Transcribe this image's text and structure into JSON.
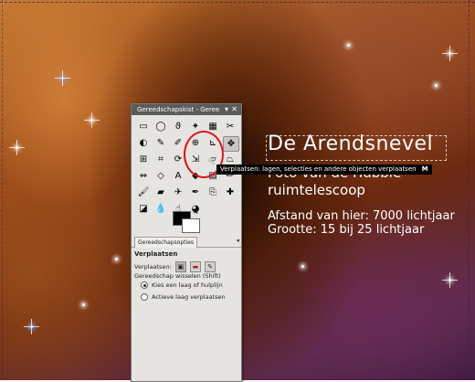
{
  "canvas": {
    "title": "De Arendsnevel",
    "subtitle_line1": "Foto van de Hubble",
    "subtitle_line2": "ruimtelescoop",
    "info_line1": "Afstand van hier: 7000 lichtjaar",
    "info_line2": "Grootte: 15 bij 25 lichtjaar"
  },
  "tooltip": {
    "text": "Verplaatsen: lagen, selecties en andere objecten verplaatsen",
    "shortcut": "M"
  },
  "toolbox": {
    "title": "Gereedschapskist - Geree",
    "controls": [
      "▾",
      "✕"
    ],
    "tools": [
      {
        "icon": "rect-select-icon",
        "glyph": "▭"
      },
      {
        "icon": "ellipse-select-icon",
        "glyph": "◯"
      },
      {
        "icon": "free-select-icon",
        "glyph": "ϑ"
      },
      {
        "icon": "fuzzy-select-icon",
        "glyph": "✦"
      },
      {
        "icon": "select-by-color-icon",
        "glyph": "▦"
      },
      {
        "icon": "scissors-select-icon",
        "glyph": "✂"
      },
      {
        "icon": "foreground-select-icon",
        "glyph": "◐"
      },
      {
        "icon": "paths-icon",
        "glyph": "✎"
      },
      {
        "icon": "color-picker-icon",
        "glyph": "✐"
      },
      {
        "icon": "zoom-icon",
        "glyph": "⊕"
      },
      {
        "icon": "measure-icon",
        "glyph": "⊾"
      },
      {
        "icon": "move-icon",
        "glyph": "✥"
      },
      {
        "icon": "align-icon",
        "glyph": "⊞"
      },
      {
        "icon": "crop-icon",
        "glyph": "⌗"
      },
      {
        "icon": "rotate-icon",
        "glyph": "⟳"
      },
      {
        "icon": "scale-icon",
        "glyph": "⇲"
      },
      {
        "icon": "shear-icon",
        "glyph": "▱"
      },
      {
        "icon": "perspective-icon",
        "glyph": "⏢"
      },
      {
        "icon": "flip-icon",
        "glyph": "⇔"
      },
      {
        "icon": "cage-icon",
        "glyph": "◇"
      },
      {
        "icon": "text-icon",
        "glyph": "A"
      },
      {
        "icon": "bucket-fill-icon",
        "glyph": "◆"
      },
      {
        "icon": "blend-icon",
        "glyph": "▤"
      },
      {
        "icon": "pencil-icon",
        "glyph": "✏"
      },
      {
        "icon": "paintbrush-icon",
        "glyph": "🖌"
      },
      {
        "icon": "eraser-icon",
        "glyph": "▰"
      },
      {
        "icon": "airbrush-icon",
        "glyph": "✈"
      },
      {
        "icon": "ink-icon",
        "glyph": "✒"
      },
      {
        "icon": "clone-icon",
        "glyph": "⎘"
      },
      {
        "icon": "heal-icon",
        "glyph": "✚"
      },
      {
        "icon": "perspective-clone-icon",
        "glyph": "◪"
      },
      {
        "icon": "blur-icon",
        "glyph": "💧"
      },
      {
        "icon": "smudge-icon",
        "glyph": "☝"
      },
      {
        "icon": "dodge-burn-icon",
        "glyph": "◕"
      }
    ],
    "tab_label": "Gereedschapsopties",
    "tab_menu": "◂",
    "options": {
      "tool_name": "Verplaatsen",
      "move_label": "Verplaatsen:",
      "switch_label": "Gereedschap wisselen (Shift)",
      "radio1": "Kies een laag of hulplijn",
      "radio2": "Actieve laag verplaatsen"
    }
  }
}
